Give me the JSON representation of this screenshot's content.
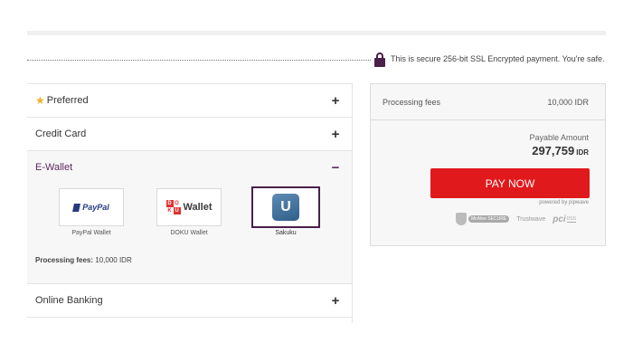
{
  "secure_notice": "This is secure 256-bit SSL Encrypted payment. You're safe.",
  "accordion": [
    {
      "label": "Preferred",
      "toggle": "+",
      "icon": "star-icon"
    },
    {
      "label": "Credit Card",
      "toggle": "+"
    },
    {
      "label": "E-Wallet",
      "toggle": "−"
    },
    {
      "label": "Online Banking",
      "toggle": "+"
    }
  ],
  "wallets": [
    {
      "name": "PayPal Wallet",
      "logo_text": "PayPal"
    },
    {
      "name": "DOKU Wallet",
      "logo_text": "Wallet",
      "logo_letters": [
        "D",
        "O",
        "K",
        "U"
      ]
    },
    {
      "name": "Sakuku",
      "logo_letter": "U",
      "selected": true
    }
  ],
  "wallet_fee": {
    "label": "Processing fees:",
    "value": "10,000 IDR"
  },
  "summary": {
    "fee_label": "Processing fees",
    "fee_value": "10,000 IDR",
    "payable_label": "Payable Amount",
    "payable_value": "297,759",
    "payable_currency": "IDR",
    "pay_button": "PAY NOW",
    "powered_by": "powered by pipwave"
  },
  "trust_badges": [
    {
      "name": "McAfee SECURE",
      "icon": "shield-icon"
    },
    {
      "name": "Trustwave"
    },
    {
      "name": "PCI DSS",
      "mark": "pci",
      "sub": "DSS"
    }
  ],
  "colors": {
    "accent": "#4a1f4a",
    "pay_button": "#e0191c",
    "star": "#f0b323"
  }
}
